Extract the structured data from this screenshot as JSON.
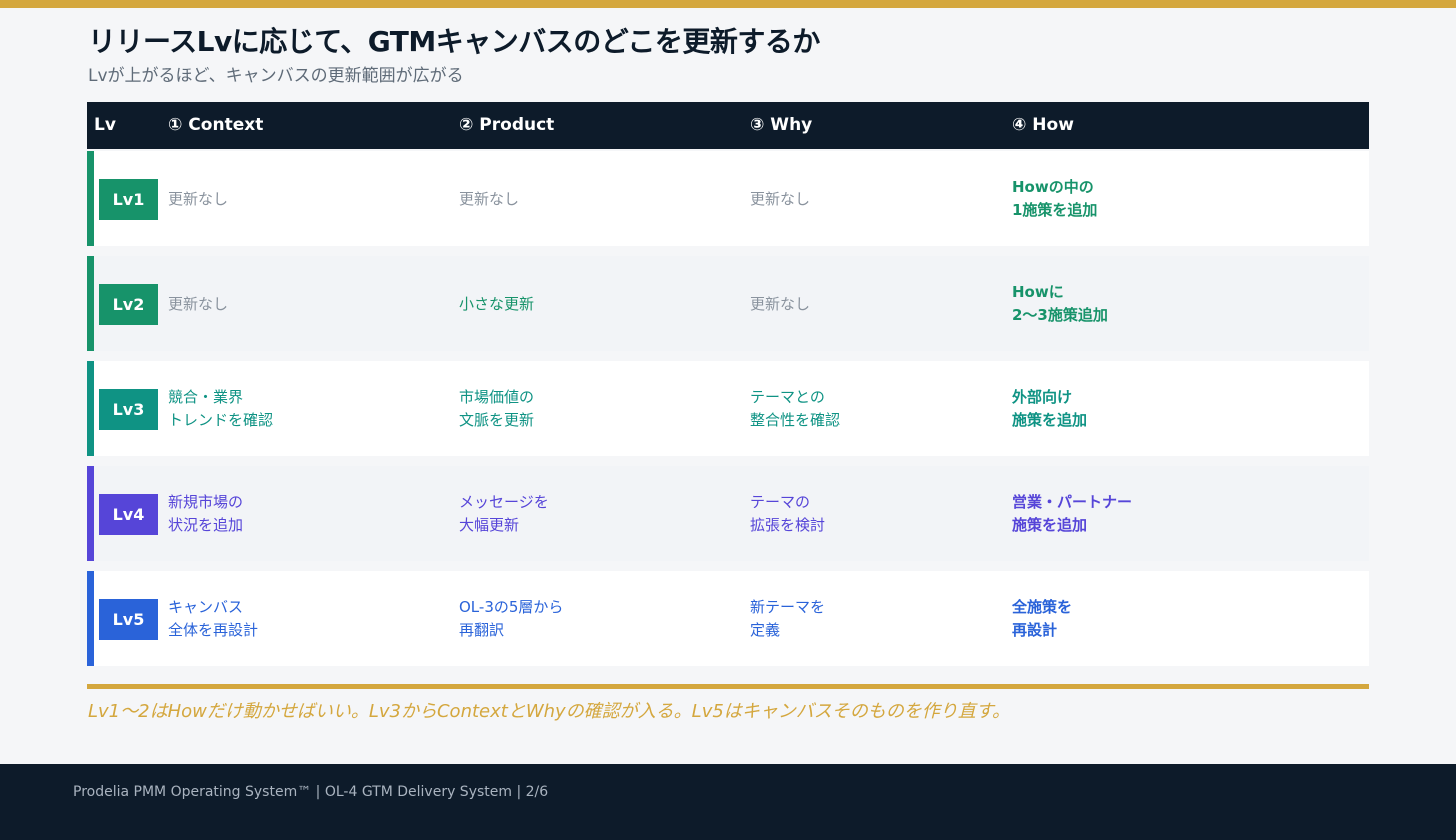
{
  "title": "リリースLvに応じて、GTMキャンバスのどこを更新するか",
  "subtitle": "Lvが上がるほど、キャンバスの更新範囲が広がる",
  "table": {
    "headers": [
      "Lv",
      "① Context",
      "② Product",
      "③ Why",
      "④ How"
    ],
    "rows": [
      {
        "lv": "Lv1",
        "color": "#17936a",
        "context": "更新なし",
        "product": "更新なし",
        "why": "更新なし",
        "how": "Howの中の\n1施策を追加",
        "muted": [
          true,
          true,
          true
        ]
      },
      {
        "lv": "Lv2",
        "color": "#17936a",
        "context": "更新なし",
        "product": "小さな更新",
        "why": "更新なし",
        "how": "Howに\n2〜3施策追加",
        "muted": [
          true,
          false,
          true
        ]
      },
      {
        "lv": "Lv3",
        "color": "#0f9384",
        "context": "競合・業界\nトレンドを確認",
        "product": "市場価値の\n文脈を更新",
        "why": "テーマとの\n整合性を確認",
        "how": "外部向け\n施策を追加",
        "muted": [
          false,
          false,
          false
        ]
      },
      {
        "lv": "Lv4",
        "color": "#5645d8",
        "context": "新規市場の\n状況を追加",
        "product": "メッセージを\n大幅更新",
        "why": "テーマの\n拡張を検討",
        "how": "営業・パートナー\n施策を追加",
        "muted": [
          false,
          false,
          false
        ]
      },
      {
        "lv": "Lv5",
        "color": "#2a63d9",
        "context": "キャンバス\n全体を再設計",
        "product": "OL-3の5層から\n再翻訳",
        "why": "新テーマを\n定義",
        "how": "全施策を\n再設計",
        "muted": [
          false,
          false,
          false
        ]
      }
    ]
  },
  "note": "Lv1〜2はHowだけ動かせばいい。Lv3からContextとWhyの確認が入る。Lv5はキャンバスそのものを作り直す。",
  "footer": "Prodelia PMM Operating System™  |  OL-4 GTM Delivery System  |  2/6",
  "colors": {
    "gold": "#d4a73e",
    "navy": "#0d1b2a",
    "muted": "#8a939e"
  }
}
